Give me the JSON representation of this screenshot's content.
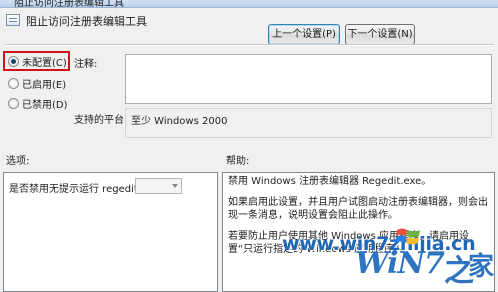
{
  "window": {
    "title": "阻止访问注册表编辑工具"
  },
  "header": {
    "policy_name": "阻止访问注册表编辑工具",
    "prev_button": "上一个设置(P)",
    "next_button": "下一个设置(N)"
  },
  "state_options": [
    {
      "label": "未配置(C)",
      "checked": true
    },
    {
      "label": "已启用(E)",
      "checked": false
    },
    {
      "label": "已禁用(D)",
      "checked": false
    }
  ],
  "comment_label": "注释:",
  "supported_label": "支持的平台:",
  "supported_value": "至少 Windows 2000",
  "options_label": "选项:",
  "help_label": "帮助:",
  "options": {
    "question": "是否禁用无提示运行 regedit？"
  },
  "help": {
    "paragraphs": [
      "禁用 Windows 注册表编辑器 Regedit.exe。",
      "如果启用此设置，并且用户试图启动注册表编辑器，则会出现一条消息，说明设置会阻止此操作。",
      "若要防止用户使用其他 Windows 应用程序，请启用设置“只运行指定的 Windows 应用程序”。"
    ]
  },
  "watermark": {
    "url": "www.win7zhijia.cn",
    "brand": "WiN7",
    "zhi": "之",
    "home": "家"
  },
  "colors": {
    "highlight": "#d0121b",
    "watermark": "#2167b8"
  }
}
